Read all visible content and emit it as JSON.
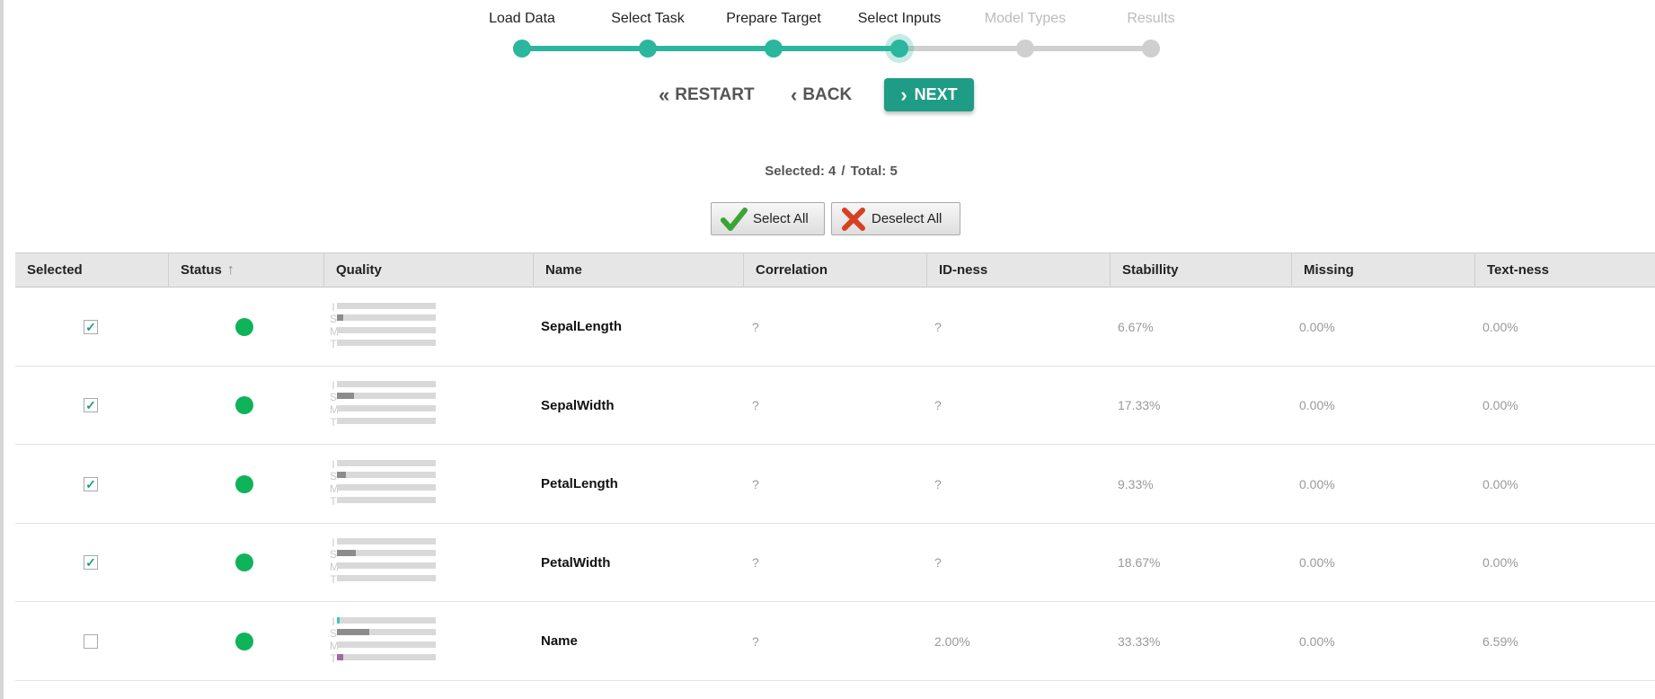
{
  "wizard": {
    "steps": [
      {
        "label": "Load Data",
        "state": "done"
      },
      {
        "label": "Select Task",
        "state": "done"
      },
      {
        "label": "Prepare Target",
        "state": "done"
      },
      {
        "label": "Select Inputs",
        "state": "active"
      },
      {
        "label": "Model Types",
        "state": "todo"
      },
      {
        "label": "Results",
        "state": "todo"
      }
    ],
    "buttons": {
      "restart": "RESTART",
      "back": "BACK",
      "next": "NEXT"
    }
  },
  "summary": {
    "selected": "Selected: 4",
    "separator": "/",
    "total": "Total: 5"
  },
  "actions": {
    "select_all": "Select All",
    "deselect_all": "Deselect All"
  },
  "colors": {
    "accent": "#2bb69e",
    "next_button": "#1f9c86",
    "status_good": "#0fb35a",
    "inactive": "#cfcfcf"
  },
  "table": {
    "columns": [
      "Selected",
      "Status",
      "Quality",
      "Name",
      "Correlation",
      "ID-ness",
      "Stabillity",
      "Missing",
      "Text-ness"
    ],
    "sort": {
      "column": "Status",
      "direction": "ascending",
      "icon": "arrow-up-icon"
    },
    "quality_letters": [
      "I",
      "S",
      "M",
      "T"
    ],
    "rows": [
      {
        "selected": true,
        "status": "good",
        "quality": [
          0,
          0.06,
          0,
          0
        ],
        "name": "SepalLength",
        "correlation": "?",
        "idness": "?",
        "stability": "6.67%",
        "missing": "0.00%",
        "textness": "0.00%"
      },
      {
        "selected": true,
        "status": "good",
        "quality": [
          0,
          0.17,
          0,
          0
        ],
        "name": "SepalWidth",
        "correlation": "?",
        "idness": "?",
        "stability": "17.33%",
        "missing": "0.00%",
        "textness": "0.00%"
      },
      {
        "selected": true,
        "status": "good",
        "quality": [
          0,
          0.09,
          0,
          0
        ],
        "name": "PetalLength",
        "correlation": "?",
        "idness": "?",
        "stability": "9.33%",
        "missing": "0.00%",
        "textness": "0.00%"
      },
      {
        "selected": true,
        "status": "good",
        "quality": [
          0,
          0.19,
          0,
          0
        ],
        "name": "PetalWidth",
        "correlation": "?",
        "idness": "?",
        "stability": "18.67%",
        "missing": "0.00%",
        "textness": "0.00%"
      },
      {
        "selected": false,
        "status": "good",
        "quality": [
          0.02,
          0.33,
          0,
          0.066
        ],
        "name": "Name",
        "correlation": "?",
        "idness": "2.00%",
        "stability": "33.33%",
        "missing": "0.00%",
        "textness": "6.59%"
      }
    ]
  }
}
